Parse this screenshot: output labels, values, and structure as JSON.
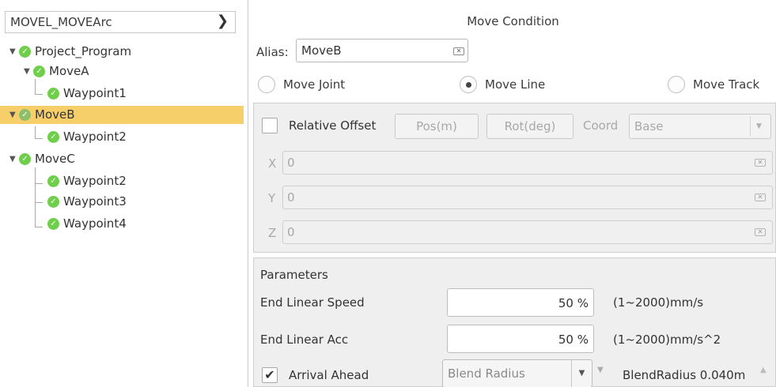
{
  "tree": {
    "header": "MOVEL_MOVEArc",
    "header_icon": "chevron-right-icon",
    "nodes": [
      {
        "label": "Project_Program"
      },
      {
        "label": "MoveA"
      },
      {
        "label": "Waypoint1"
      },
      {
        "label": "MoveB"
      },
      {
        "label": "Waypoint2"
      },
      {
        "label": "MoveC"
      },
      {
        "label": "Waypoint2"
      },
      {
        "label": "Waypoint3"
      },
      {
        "label": "Waypoint4"
      }
    ],
    "selected_color": "#f7cf6a",
    "check_color": "#6fcf4b"
  },
  "condition": {
    "title": "Move Condition",
    "alias_label": "Alias:",
    "alias_value": "MoveB",
    "radios": [
      {
        "label": "Move Joint",
        "selected": false
      },
      {
        "label": "Move Line",
        "selected": true
      },
      {
        "label": "Move Track",
        "selected": false
      }
    ],
    "offset": {
      "relative_label": "Relative Offset",
      "pos_btn": "Pos(m)",
      "rot_btn": "Rot(deg)",
      "coord_label": "Coord",
      "coord_value": "Base",
      "axes": [
        {
          "name": "X",
          "value": "0"
        },
        {
          "name": "Y",
          "value": "0"
        },
        {
          "name": "Z",
          "value": "0"
        }
      ]
    },
    "params": {
      "title": "Parameters",
      "speed_label": "End Linear Speed",
      "speed_value": "50 %",
      "speed_range": "(1~2000)mm/s",
      "acc_label": "End Linear Acc",
      "acc_value": "50 %",
      "acc_range": "(1~2000)mm/s^2",
      "arrival_label": "Arrival Ahead",
      "arrival_checked": true,
      "blend_mode": "Blend Radius",
      "blend_value": "BlendRadius 0.040m"
    }
  }
}
